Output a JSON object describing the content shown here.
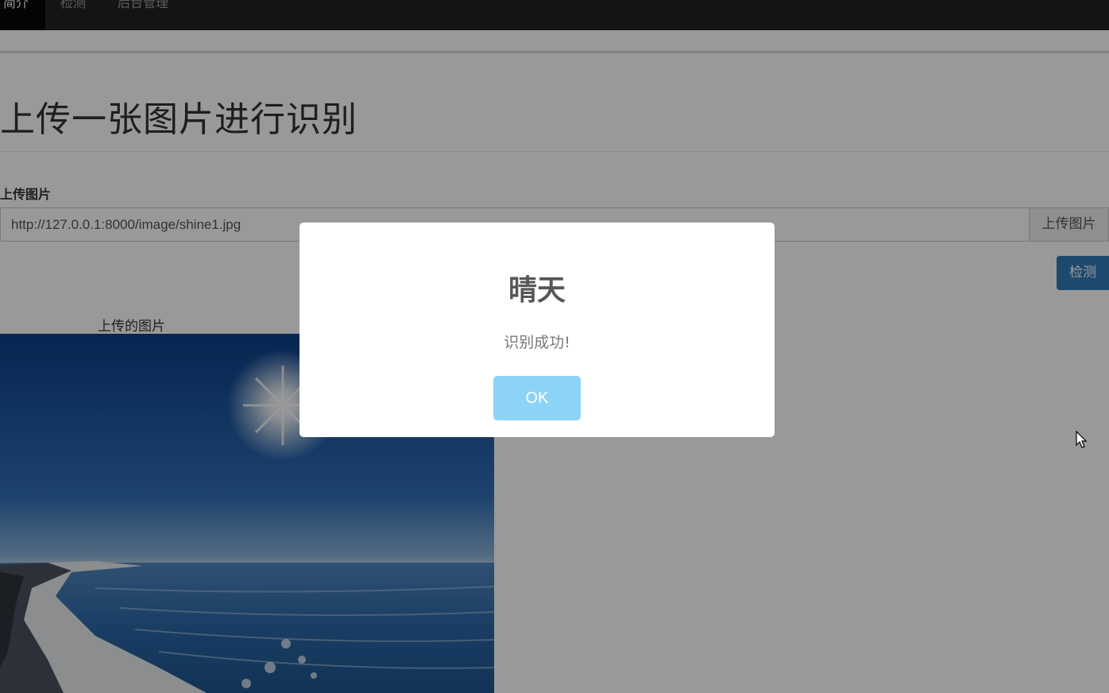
{
  "nav": {
    "items": [
      {
        "label": "简介",
        "active": true
      },
      {
        "label": "检测",
        "active": false
      },
      {
        "label": "后台管理",
        "active": false
      }
    ]
  },
  "main": {
    "title": "上传一张图片进行识别",
    "upload_label": "上传图片",
    "url_value": "http://127.0.0.1:8000/image/shine1.jpg",
    "upload_button": "上传图片",
    "detect_button": "检测",
    "image_caption": "上传的图片"
  },
  "dialog": {
    "title": "晴天",
    "message": "识别成功!",
    "ok_label": "OK"
  },
  "colors": {
    "navbar": "#222222",
    "primary": "#337ab7",
    "ok_button": "#8cd4f5"
  }
}
